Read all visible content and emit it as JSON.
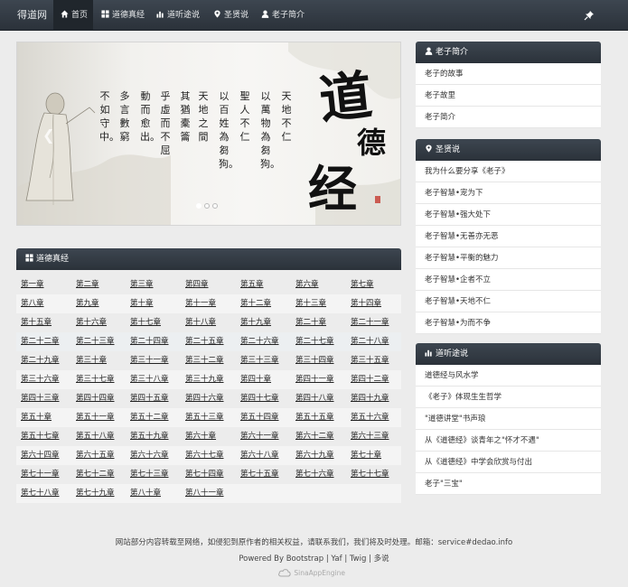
{
  "nav": {
    "brand": "得道网",
    "items": [
      {
        "label": "首页",
        "icon": "home-icon"
      },
      {
        "label": "道德真经",
        "icon": "grid-icon"
      },
      {
        "label": "道听途说",
        "icon": "bar-chart-icon"
      },
      {
        "label": "圣贤说",
        "icon": "map-marker-icon"
      },
      {
        "label": "老子简介",
        "icon": "user-icon"
      }
    ],
    "pin_icon": "pushpin-icon"
  },
  "carousel": {
    "poem_columns": [
      "天地不仁",
      "以萬物為芻狗。",
      "聖人不仁",
      "以百姓為芻狗。",
      "天地之間",
      "其猶橐籥",
      "乎虛而不屈",
      "動而愈出。",
      "多言數窮",
      "不如守中。"
    ],
    "title_chars": [
      "道",
      "德",
      "经"
    ],
    "active_slide": 1,
    "slide_count": 3
  },
  "chapters": {
    "title": "道德真经",
    "items": [
      "第一章",
      "第二章",
      "第三章",
      "第四章",
      "第五章",
      "第六章",
      "第七章",
      "第八章",
      "第九章",
      "第十章",
      "第十一章",
      "第十二章",
      "第十三章",
      "第十四章",
      "第十五章",
      "第十六章",
      "第十七章",
      "第十八章",
      "第十九章",
      "第二十章",
      "第二十一章",
      "第二十二章",
      "第二十三章",
      "第二十四章",
      "第二十五章",
      "第二十六章",
      "第二十七章",
      "第二十八章",
      "第二十九章",
      "第三十章",
      "第三十一章",
      "第三十二章",
      "第三十三章",
      "第三十四章",
      "第三十五章",
      "第三十六章",
      "第三十七章",
      "第三十八章",
      "第三十九章",
      "第四十章",
      "第四十一章",
      "第四十二章",
      "第四十三章",
      "第四十四章",
      "第四十五章",
      "第四十六章",
      "第四十七章",
      "第四十八章",
      "第四十九章",
      "第五十章",
      "第五十一章",
      "第五十二章",
      "第五十三章",
      "第五十四章",
      "第五十五章",
      "第五十六章",
      "第五十七章",
      "第五十八章",
      "第五十九章",
      "第六十章",
      "第六十一章",
      "第六十二章",
      "第六十三章",
      "第六十四章",
      "第六十五章",
      "第六十六章",
      "第六十七章",
      "第六十八章",
      "第六十九章",
      "第七十章",
      "第七十一章",
      "第七十二章",
      "第七十三章",
      "第七十四章",
      "第七十五章",
      "第七十六章",
      "第七十七章",
      "第七十八章",
      "第七十九章",
      "第八十章",
      "第八十一章"
    ]
  },
  "sidebar": {
    "laozi": {
      "title": "老子简介",
      "items": [
        "老子的故事",
        "老子故里",
        "老子简介"
      ]
    },
    "sages": {
      "title": "圣贤说",
      "items": [
        "我为什么要分享《老子》",
        "老子智慧•宠为下",
        "老子智慧•强大处下",
        "老子智慧•无善亦无恶",
        "老子智慧•平衡的魅力",
        "老子智慧•企者不立",
        "老子智慧•天地不仁",
        "老子智慧•为而不争"
      ]
    },
    "hearsay": {
      "title": "道听途说",
      "items": [
        "道德经与风水学",
        "《老子》体现生生哲学",
        "\"道德讲堂\"书声琅",
        "从《道德经》谈青年之\"怀才不遇\"",
        "从《道德经》中学会欣赏与付出",
        "老子\"三宝\""
      ]
    }
  },
  "footer": {
    "notice": "网站部分内容转载至网络，如侵犯到原作者的相关权益，请联系我们，我们将及时处理。邮箱：service#dedao.info",
    "powered": "Powered By Bootstrap | Yaf | Twig | 多说",
    "sae": "SinaAppEngine"
  }
}
